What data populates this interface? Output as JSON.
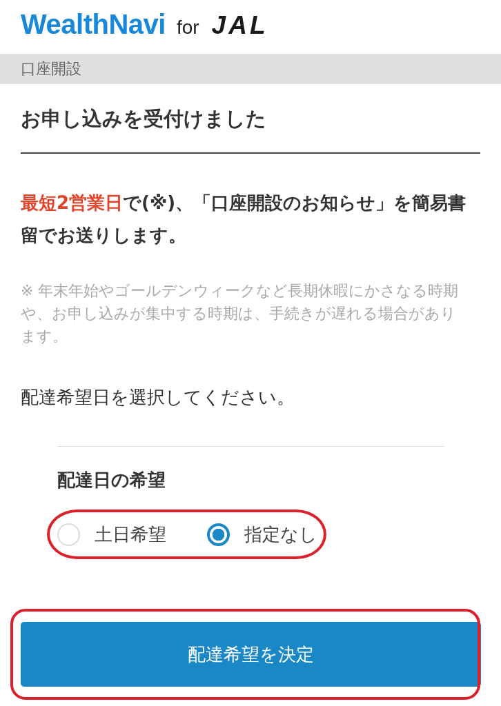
{
  "logo": {
    "brand": "WealthNavi",
    "connector": "for",
    "partner": "JAL"
  },
  "breadcrumb": "口座開設",
  "title": "お申し込みを受付けました",
  "lead": [
    {
      "text": "最短2営業日",
      "emphasis": true
    },
    {
      "text": "で(※)、「口座開設のお知らせ」を簡易書留でお送りします。",
      "emphasis": false
    }
  ],
  "note": "※ 年末年始やゴールデンウィークなど長期休暇にかさなる時期や、お申し込みが集中する時期は、手続きが遅れる場合があります。",
  "prompt": "配達希望日を選択してください。",
  "delivery": {
    "label": "配達日の希望",
    "highlighted": true,
    "options": [
      {
        "label": "土日希望",
        "selected": false
      },
      {
        "label": "指定なし",
        "selected": true
      }
    ]
  },
  "submit": {
    "label": "配達希望を決定",
    "highlighted": true
  }
}
